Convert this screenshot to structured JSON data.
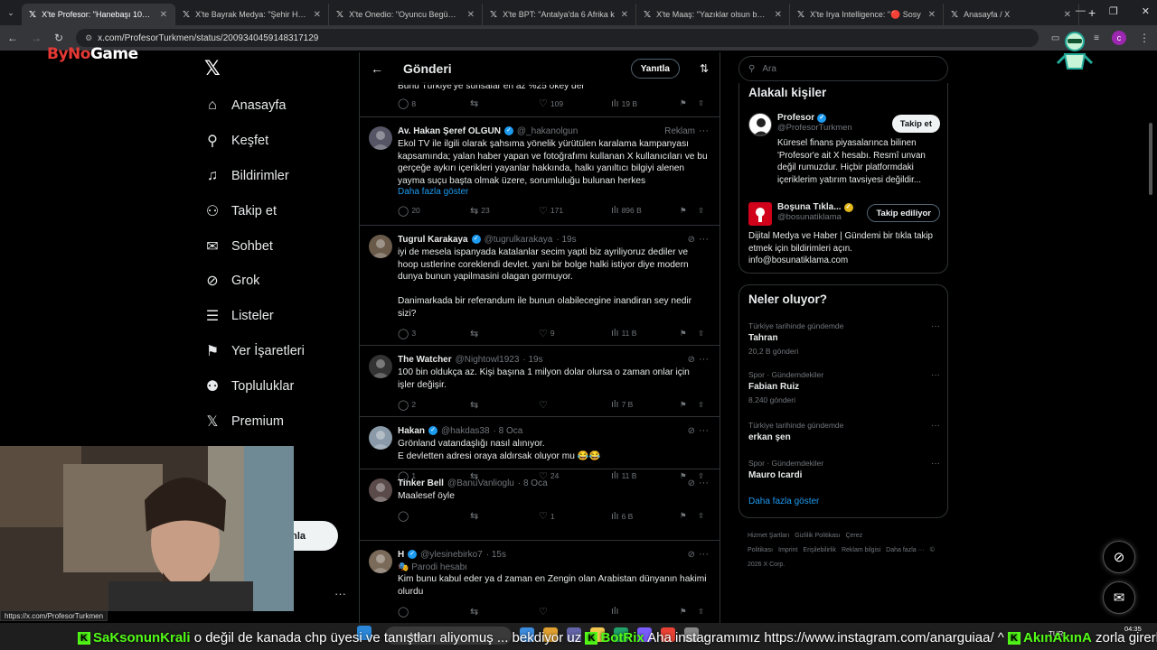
{
  "browser": {
    "tabs": [
      {
        "label": "X'te Profesor: \"Hanebaşı 100k d",
        "active": true
      },
      {
        "label": "X'te Bayrak Medya: \"Şehir Hast"
      },
      {
        "label": "X'te Onedio: \"Oyuncu Begüm Ö"
      },
      {
        "label": "X'te BPT: \"Antalya'da 6 Afrika k"
      },
      {
        "label": "X'te Maaş: \"Yazıklar olsun böyle"
      },
      {
        "label": "X'te Irya Intelligence: \"🔴 Sosy"
      },
      {
        "label": "Anasayfa / X"
      }
    ],
    "new_tab": "+",
    "url": "x.com/ProfesorTurkmen/status/2009340459148317129",
    "profile_initial": "c",
    "status_url": "https://x.com/ProfesorTurkmen"
  },
  "brand": {
    "prefix": "ByNo",
    "suffix": "Game"
  },
  "nav": {
    "items": [
      {
        "label": "Anasayfa",
        "icon": "home-icon"
      },
      {
        "label": "Keşfet",
        "icon": "search-icon"
      },
      {
        "label": "Bildirimler",
        "icon": "bell-icon"
      },
      {
        "label": "Takip et",
        "icon": "person-plus-icon"
      },
      {
        "label": "Sohbet",
        "icon": "mail-icon"
      },
      {
        "label": "Grok",
        "icon": "grok-icon"
      },
      {
        "label": "Listeler",
        "icon": "list-icon"
      },
      {
        "label": "Yer İşaretleri",
        "icon": "bookmark-icon"
      },
      {
        "label": "Topluluklar",
        "icon": "people-icon"
      },
      {
        "label": "Premium",
        "icon": "x-logo-icon"
      }
    ],
    "post_partial": "nla"
  },
  "center": {
    "title": "Gönderi",
    "reply_button": "Yanıtla",
    "partial_top_text": "Bunu Türkiye'ye sunsalar en az %25 okey der",
    "partial_top_stats": {
      "replies": "8",
      "reposts": "",
      "likes": "109",
      "views": "19 B"
    },
    "tweets": [
      {
        "name": "Av. Hakan Şeref OLGUN",
        "handle": "@_hakanolgun",
        "verified": "blue",
        "time": "",
        "ad": "Reklam",
        "text": "Ekol TV ile ilgili olarak şahsıma yönelik yürütülen karalama kampanyası kapsamında; yalan haber yapan ve fotoğrafımı kullanan X kullanıcıları ve bu gerçeğe aykırı içerikleri yayanlar hakkında, halkı yanıltıcı bilgiyi alenen yayma suçu başta olmak üzere, sorumluluğu bulunan herkes",
        "more": "Daha fazla göster",
        "stats": {
          "replies": "20",
          "reposts": "23",
          "likes": "171",
          "views": "896 B"
        }
      },
      {
        "name": "Tugrul Karakaya",
        "handle": "@tugrulkarakaya",
        "verified": "blue",
        "time": "· 19s",
        "ad": "",
        "text": "iyi de mesela ispanyada katalanlar secim yapti biz ayriliyoruz dediler ve hoop ustlerine coreklendi devlet. yani bir bolge halki istiyor diye modern dunya bunun yapilmasini olagan gormuyor.\n\nDanimarkada bir referandum ile bunun olabilecegine inandiran sey nedir sizi?",
        "more": "",
        "stats": {
          "replies": "3",
          "reposts": "",
          "likes": "9",
          "views": "11 B"
        }
      },
      {
        "name": "The Watcher",
        "handle": "@Nightowl1923",
        "verified": "",
        "time": "· 19s",
        "ad": "",
        "text": "100 bin oldukça az. Kişi başına 1 milyon dolar olursa o zaman onlar için işler değişir.",
        "more": "",
        "stats": {
          "replies": "2",
          "reposts": "",
          "likes": "",
          "views": "7 B"
        }
      },
      {
        "name": "Hakan",
        "handle": "@hakdas38",
        "verified": "blue",
        "time": "· 8 Oca",
        "ad": "",
        "text": "Grönland vatandaşlığı nasıl alınıyor.\nE devletten adresi oraya aldırsak oluyor mu 😂😂",
        "more": "",
        "stats": {
          "replies": "1",
          "reposts": "",
          "likes": "24",
          "views": "11 B"
        }
      },
      {
        "name": "Tinker Bell",
        "handle": "@BanuVanlioglu",
        "verified": "",
        "time": "· 8 Oca",
        "ad": "",
        "text": "Maalesef öyle",
        "more": "",
        "stats": {
          "replies": "",
          "reposts": "",
          "likes": "1",
          "views": "6 B"
        }
      },
      {
        "name": "H",
        "handle": "@ylesinebirko7",
        "verified": "blue",
        "time": "· 15s",
        "ad": "",
        "sub": "🎭 Parodi hesabı",
        "text": "Kim bunu kabul eder ya d zaman en Zengin olan Arabistan dünyanın hakimi olurdu",
        "more": "",
        "stats": {
          "replies": "",
          "reposts": "",
          "likes": "",
          "views": ""
        }
      }
    ]
  },
  "right": {
    "search_placeholder": "Ara",
    "related_title": "Alakalı kişiler",
    "people": [
      {
        "name": "Profesor",
        "handle": "@ProfesorTurkmen",
        "verified": "blue",
        "button": "Takip et",
        "bio": "Küresel finans piyasalarınca bilinen 'Profesor'e ait X hesabı. Resmî unvan değil rumuzdur. Hiçbir platformdaki içeriklerim yatırım tavsiyesi değildir..."
      },
      {
        "name": "Boşuna Tıkla...",
        "handle": "@bosunatiklama",
        "verified": "gold",
        "button": "Takip ediliyor",
        "bio": "Dijital Medya ve Haber | Gündemi bir tıkla takip etmek için bildirimleri açın. info@bosunatiklama.com"
      }
    ],
    "trends_title": "Neler oluyor?",
    "trends": [
      {
        "category": "Türkiye tarihinde gündemde",
        "name": "Tahran",
        "count": "20,2 B gönderi"
      },
      {
        "category": "Spor · Gündemdekiler",
        "name": "Fabian Ruiz",
        "count": "8.240 gönderi"
      },
      {
        "category": "Türkiye tarihinde gündemde",
        "name": "erkan şen",
        "count": ""
      },
      {
        "category": "Spor · Gündemdekiler",
        "name": "Mauro Icardi",
        "count": ""
      }
    ],
    "show_more": "Daha fazla göster",
    "footer": [
      "Hizmet Şartları",
      "Gizlilik Politikası",
      "Çerez Politikası",
      "Imprint",
      "Erişilebilirlik",
      "Reklam bilgisi",
      "Daha fazla ···",
      "© 2026 X Corp."
    ]
  },
  "taskbar": {
    "search": "Ara",
    "time": "04:35",
    "lang": "TUR"
  },
  "chat": {
    "segments": [
      {
        "user": "SaKsonunKrali",
        "text": " o değil de kanada chp üyesi ve tanıştları aliyomuş ... bekdiyor uz "
      },
      {
        "user": "BotRix",
        "text": " Aha instagramımız https://www.instagram.com/anarguiaa/ ^ "
      },
      {
        "user": "AkınAkınA",
        "text": " zorla girerler"
      }
    ]
  },
  "colors": {
    "accent": "#1d9bf0",
    "gold": "#e2b719",
    "border": "#2f3336",
    "muted": "#71767b",
    "kick": "#53fc18"
  }
}
